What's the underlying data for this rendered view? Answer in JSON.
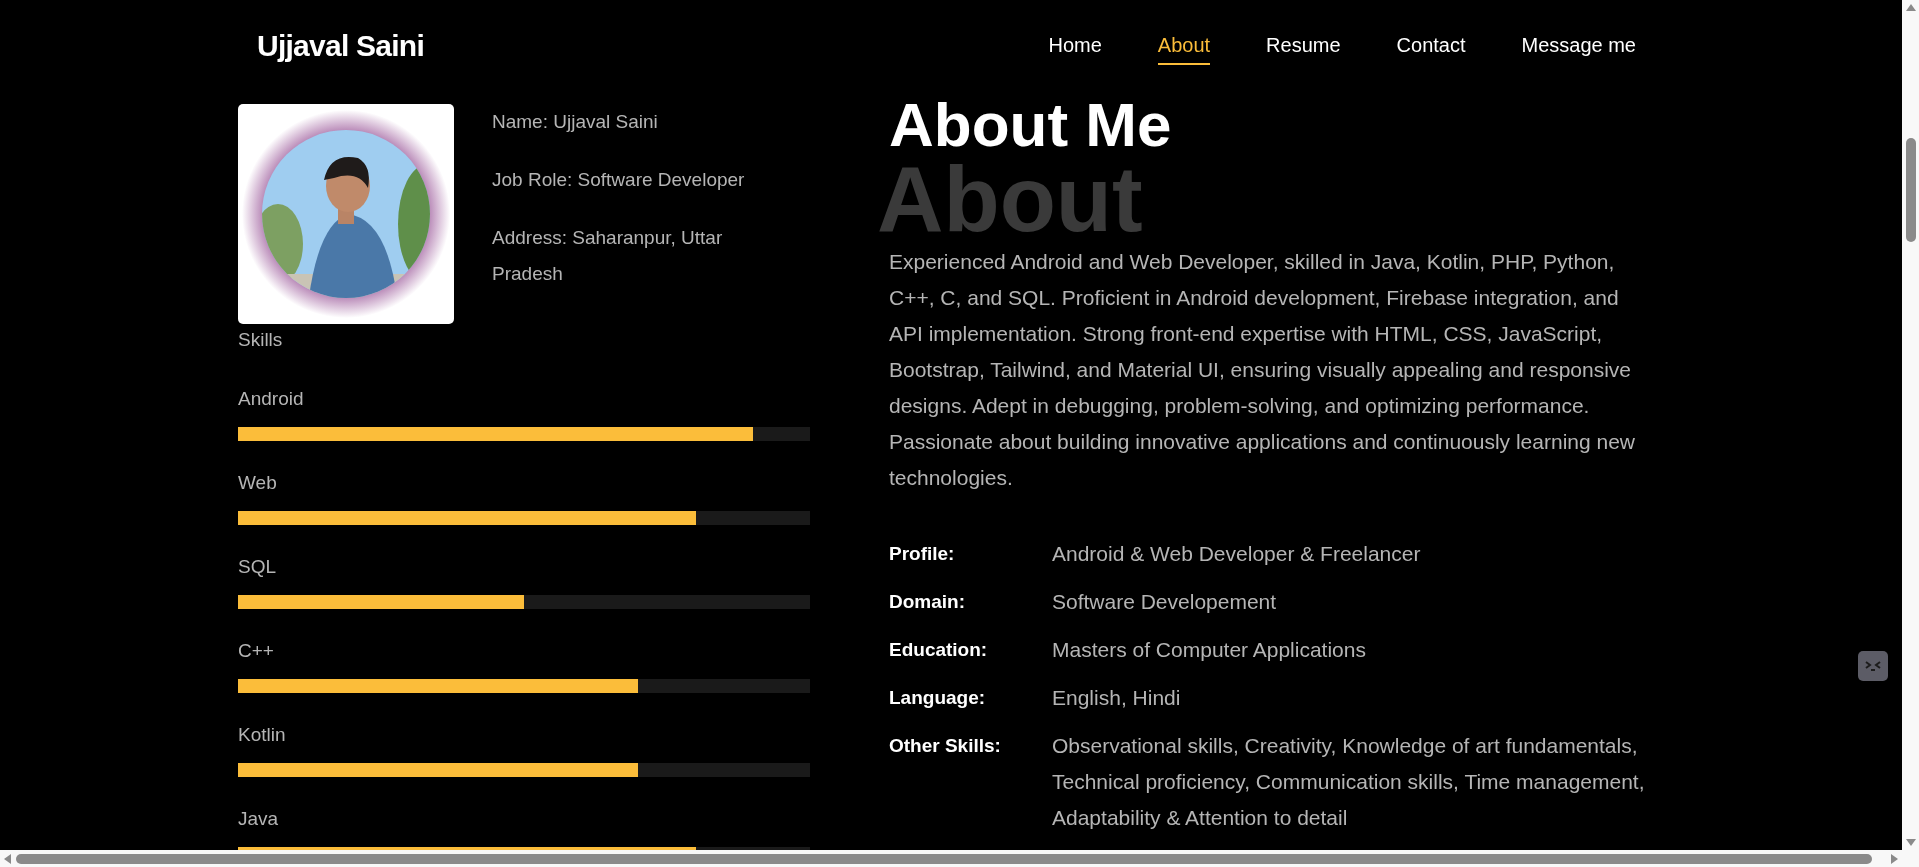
{
  "brand": "Ujjaval Saini",
  "nav": [
    {
      "label": "Home",
      "selected": false
    },
    {
      "label": "About",
      "selected": true
    },
    {
      "label": "Resume",
      "selected": false
    },
    {
      "label": "Contact",
      "selected": false
    },
    {
      "label": "Message me",
      "selected": false
    }
  ],
  "profile": {
    "details": [
      "Name: Ujjaval Saini",
      "Job Role: Software Developer",
      "Address: Saharanpur, Uttar Pradesh"
    ]
  },
  "skills": {
    "title": "Skills",
    "items": [
      {
        "name": "Android",
        "level": 0.9
      },
      {
        "name": "Web",
        "level": 0.8
      },
      {
        "name": "SQL",
        "level": 0.5
      },
      {
        "name": "C++",
        "level": 0.7
      },
      {
        "name": "Kotlin",
        "level": 0.7
      },
      {
        "name": "Java",
        "level": 0.8
      }
    ]
  },
  "about": {
    "background_word": "About",
    "heading": "About Me",
    "paragraph": "Experienced Android and Web Developer, skilled in Java, Kotlin, PHP, Python, C++, C, and SQL. Proficient in Android development, Firebase integration, and API implementation. Strong front-end expertise with HTML, CSS, JavaScript, Bootstrap, Tailwind, and Material UI, ensuring visually appealing and responsive designs. Adept in debugging, problem-solving, and optimizing performance. Passionate about building innovative applications and continuously learning new technologies.",
    "facts": [
      {
        "label": "Profile:",
        "value": "Android & Web Developer & Freelancer"
      },
      {
        "label": "Domain:",
        "value": "Software Developement"
      },
      {
        "label": "Education:",
        "value": "Masters of Computer Applications"
      },
      {
        "label": "Language:",
        "value": "English, Hindi"
      },
      {
        "label": "Other Skills:",
        "value": "Observational skills, Creativity, Knowledge of art fundamentals, Technical proficiency, Communication skills, Time management, Adaptability & Attention to detail"
      }
    ]
  }
}
